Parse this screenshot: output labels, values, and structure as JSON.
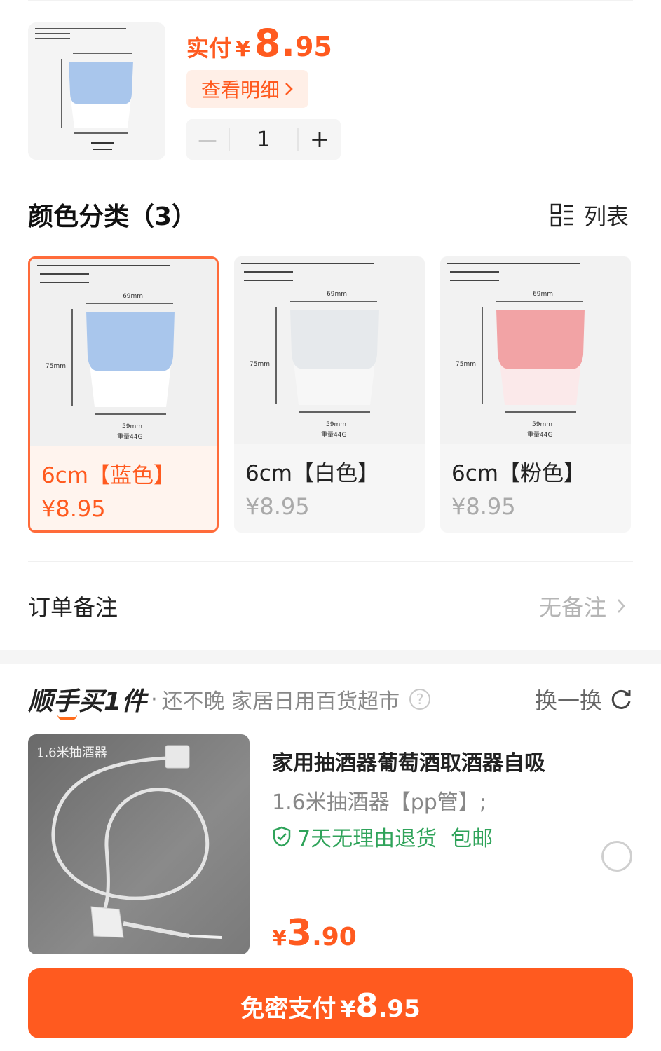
{
  "product": {
    "thumb_icon": "cup-image",
    "price_label": "实付",
    "price_symbol": "¥",
    "price_int": "8.",
    "price_dec": "95",
    "detail_label": "查看明细",
    "quantity": "1",
    "minus": "－",
    "plus": "+"
  },
  "variants": {
    "title": "颜色分类（3）",
    "list_label": "列表",
    "items": [
      {
        "name": "6cm【蓝色】",
        "price": "¥8.95",
        "color": "#a9c6ec",
        "selected": true
      },
      {
        "name": "6cm【白色】",
        "price": "¥8.95",
        "color": "#e9ecef",
        "selected": false
      },
      {
        "name": "6cm【粉色】",
        "price": "¥8.95",
        "color": "#f2a3a5",
        "selected": false
      }
    ],
    "img_labels": {
      "width_top": "69mm",
      "height": "75mm",
      "width_bottom": "59mm",
      "weight": "重量44G"
    }
  },
  "order_note": {
    "label": "订单备注",
    "value": "无备注"
  },
  "addon": {
    "brand": "顺手买1件",
    "dot": "·",
    "subtitle": "还不晚 家居日用百货超市",
    "swap_label": "换一换",
    "image_label": "1.6米抽酒器",
    "title": "家用抽酒器葡萄酒取酒器自吸",
    "spec": "1.6米抽酒器【pp管】;",
    "tag_return": "7天无理由退货",
    "tag_shipping": "包邮",
    "price_symbol": "¥",
    "price_int": "3",
    "price_dec": ".90"
  },
  "pay": {
    "label": "免密支付",
    "symbol": "¥",
    "int": "8",
    "dec": ".95"
  },
  "colors": {
    "accent": "#ff5a1f",
    "green": "#2fa35a"
  }
}
